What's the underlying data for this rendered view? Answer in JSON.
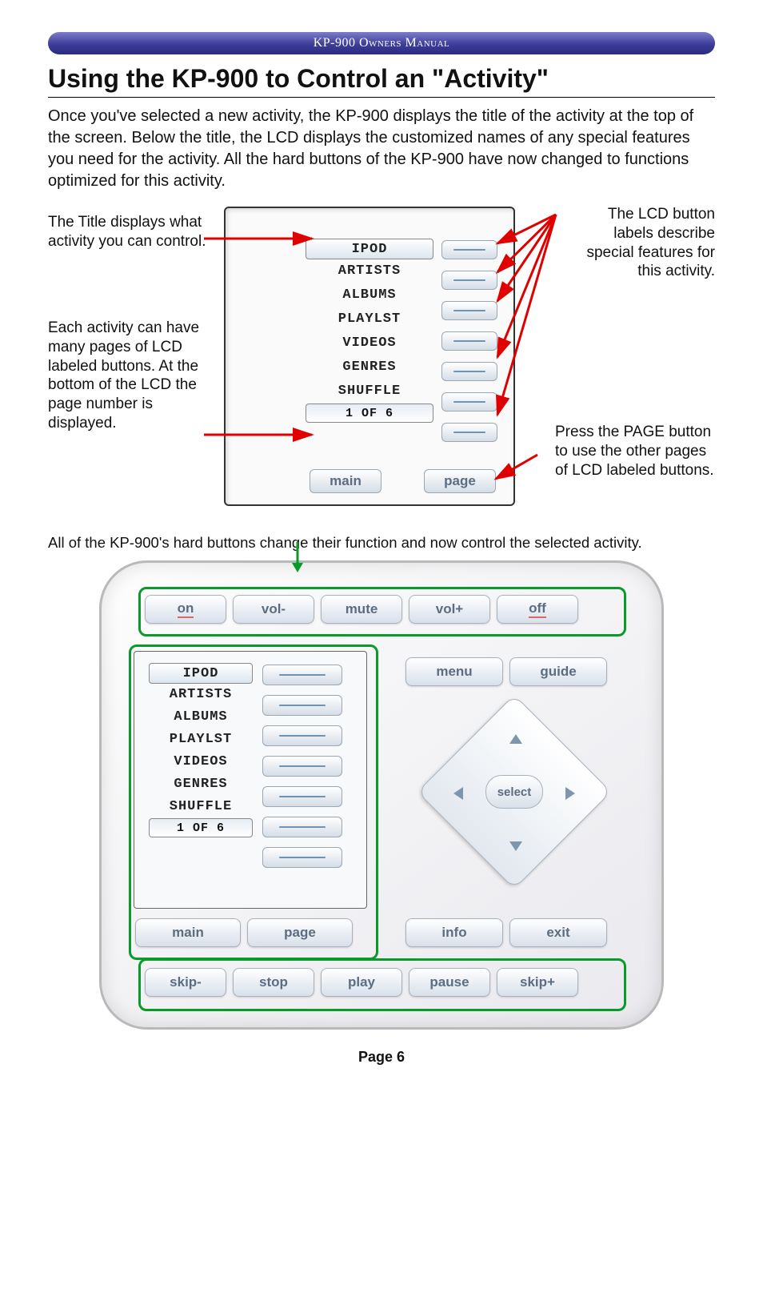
{
  "header": "KP-900 Owners Manual",
  "section_title": "Using the KP-900 to Control an \"Activity\"",
  "intro": "Once you've selected a new activity, the KP-900 displays the title of the activity at the top of the screen. Below the title, the LCD displays the customized names of any special features you need for the activity. All the hard buttons of the KP-900 have now changed to functions optimized for this activity.",
  "callouts": {
    "title": "The Title displays what activity you can control.",
    "pages": "Each activity can have many pages of LCD labeled buttons. At the bottom of the LCD the page number is displayed.",
    "lcd_labels": "The LCD button labels describe special features for this activity.",
    "page_btn": "Press the PAGE button to use the other pages of LCD labeled buttons."
  },
  "lcd": {
    "title": "IPOD",
    "items": [
      "ARTISTS",
      "ALBUMS",
      "PLAYLST",
      "VIDEOS",
      "GENRES",
      "SHUFFLE"
    ],
    "page_indicator": "1 OF 6",
    "main": "main",
    "page": "page"
  },
  "caption": "All of the KP-900's hard buttons change their function and now control the selected activity.",
  "remote": {
    "top_row": [
      "on",
      "vol-",
      "mute",
      "vol+",
      "off"
    ],
    "right_top": [
      "menu",
      "guide"
    ],
    "select": "select",
    "mid_left": [
      "main",
      "page"
    ],
    "mid_right": [
      "info",
      "exit"
    ],
    "bottom_row": [
      "skip-",
      "stop",
      "play",
      "pause",
      "skip+"
    ]
  },
  "page_number": "Page 6"
}
